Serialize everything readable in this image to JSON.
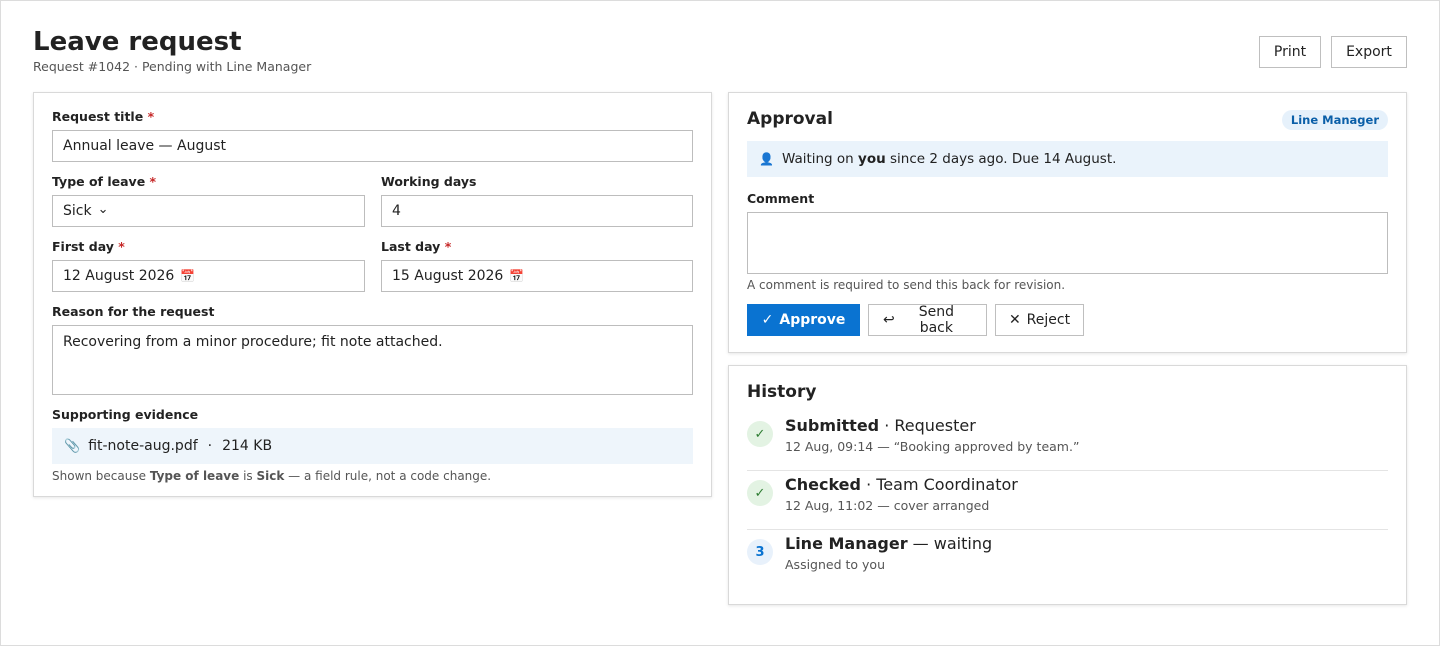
{
  "page": {
    "title": "Leave request",
    "subtitle": "Request #1042 · Pending with Line Manager",
    "print_label": "Print",
    "export_label": "Export"
  },
  "form": {
    "request_title_label": "Request title",
    "request_title_value": "Annual leave — August",
    "type_label": "Type of leave",
    "type_value": "Sick",
    "working_days_label": "Working days",
    "working_days_value": "4",
    "first_day_label": "First day",
    "first_day_value": "12 August 2026",
    "last_day_label": "Last day",
    "last_day_value": "15 August 2026",
    "reason_label": "Reason for the request",
    "reason_value": "Recovering from a minor procedure; fit note attached.",
    "evidence_label": "Supporting evidence",
    "attachment_name": "fit-note-aug.pdf",
    "attachment_sep": "·",
    "attachment_size": "214 KB",
    "rule_hint_prefix": "Shown because ",
    "rule_hint_field": "Type of leave",
    "rule_hint_is": " is ",
    "rule_hint_value": "Sick",
    "rule_hint_suffix": " — a field rule, not a code change.",
    "required_mark": "*"
  },
  "approval": {
    "title": "Approval",
    "badge": "Line Manager",
    "notice_prefix": "Waiting on ",
    "notice_you": "you",
    "notice_suffix": " since 2 days ago. Due 14 August.",
    "comment_label": "Comment",
    "comment_value": "",
    "comment_hint": "A comment is required to send this back for revision.",
    "approve_label": "Approve",
    "send_back_label": "Send back",
    "reject_label": "Reject"
  },
  "history": {
    "title": "History",
    "items": [
      {
        "status": "done",
        "marker": "✓",
        "title": "Submitted",
        "role": " · Requester",
        "sub": "12 Aug, 09:14 — “Booking approved by team.”"
      },
      {
        "status": "done",
        "marker": "✓",
        "title": "Checked",
        "role": " · Team Coordinator",
        "sub": "12 Aug, 11:02 — cover arranged"
      },
      {
        "status": "current",
        "marker": "3",
        "title": "Line Manager",
        "role": " — waiting",
        "sub": "Assigned to you"
      }
    ]
  },
  "icons": {
    "caret": "⌄",
    "calendar": "📅",
    "paperclip": "📎",
    "user": "👤",
    "check": "✓",
    "undo": "↩",
    "cross": "✕"
  },
  "colors": {
    "primary": "#0a73d1",
    "required": "#c62828",
    "success": "#2e7d32",
    "notice_bg": "#eaf3fb"
  }
}
